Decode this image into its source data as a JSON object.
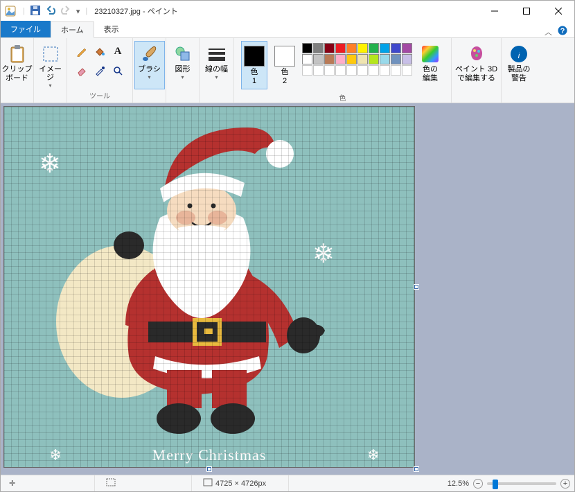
{
  "title": {
    "filename": "23210327.jpg",
    "app": "ペイント"
  },
  "tabs": {
    "file": "ファイル",
    "home": "ホーム",
    "view": "表示"
  },
  "groups": {
    "clipboard": {
      "label": "クリップ\nボード",
      "group": ""
    },
    "image": "イメージ",
    "tools": "ツール",
    "brushes": "ブラシ",
    "shapes": "図形",
    "width": "線の幅",
    "color1": {
      "btn": "色\n1",
      "label": ""
    },
    "color2": {
      "btn": "色\n2"
    },
    "colors_group": "色",
    "edit_colors": "色の\n編集",
    "paint3d": "ペイント 3D\nで編集する",
    "alerts": "製品の\n警告"
  },
  "palette_row1": [
    "#000000",
    "#7f7f7f",
    "#880015",
    "#ed1c24",
    "#ff7f27",
    "#fff200",
    "#22b14c",
    "#00a2e8",
    "#3f48cc",
    "#a349a4"
  ],
  "palette_row2": [
    "#ffffff",
    "#c3c3c3",
    "#b97a57",
    "#ffaec9",
    "#ffc90e",
    "#efe4b0",
    "#b5e61d",
    "#99d9ea",
    "#7092be",
    "#c8bfe7"
  ],
  "color1_value": "#000000",
  "color2_value": "#ffffff",
  "status": {
    "dims": "4725 × 4726px",
    "zoom": "12.5%"
  },
  "canvas_text": "Merry Christmas",
  "canvas_bg": "#8ec0bd"
}
